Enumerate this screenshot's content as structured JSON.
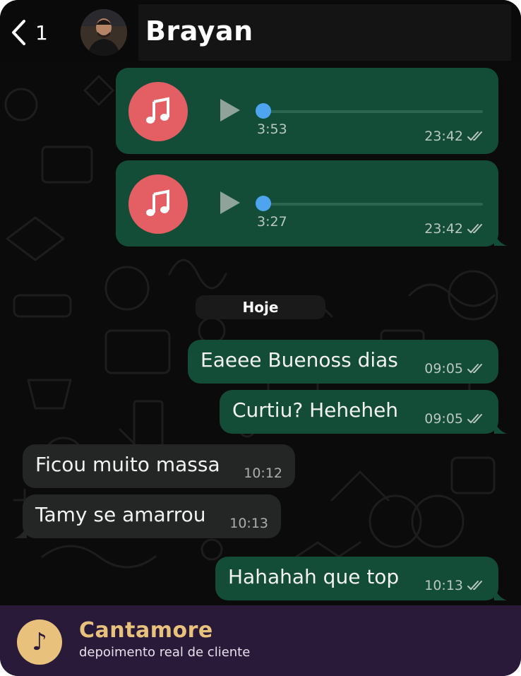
{
  "header": {
    "back_count": "1",
    "contact_name": "Brayan"
  },
  "messages": {
    "audio_1": {
      "duration": "3:53",
      "time": "23:42"
    },
    "audio_2": {
      "duration": "3:27",
      "time": "23:42"
    },
    "date_divider": "Hoje",
    "m1": {
      "text": "Eaeee Buenoss dias",
      "time": "09:05"
    },
    "m2": {
      "text": "Curtiu? Heheheh",
      "time": "09:05"
    },
    "m3": {
      "text": "Ficou muito massa",
      "time": "10:12"
    },
    "m4": {
      "text": "Tamy se amarrou",
      "time": "10:13"
    },
    "m5": {
      "text": "Hahahah que top",
      "time": "10:13"
    }
  },
  "footer": {
    "logo_glyph": "♪",
    "brand": "Cantamore",
    "subtitle": "depoimento real de cliente"
  },
  "colors": {
    "outgoing_bubble": "#144d37",
    "incoming_bubble": "#242626",
    "music_icon": "#e45f63",
    "progress_knob": "#4ea4ee",
    "footer_bg": "#2a1a3a",
    "brand_gold": "#e8c27c"
  }
}
